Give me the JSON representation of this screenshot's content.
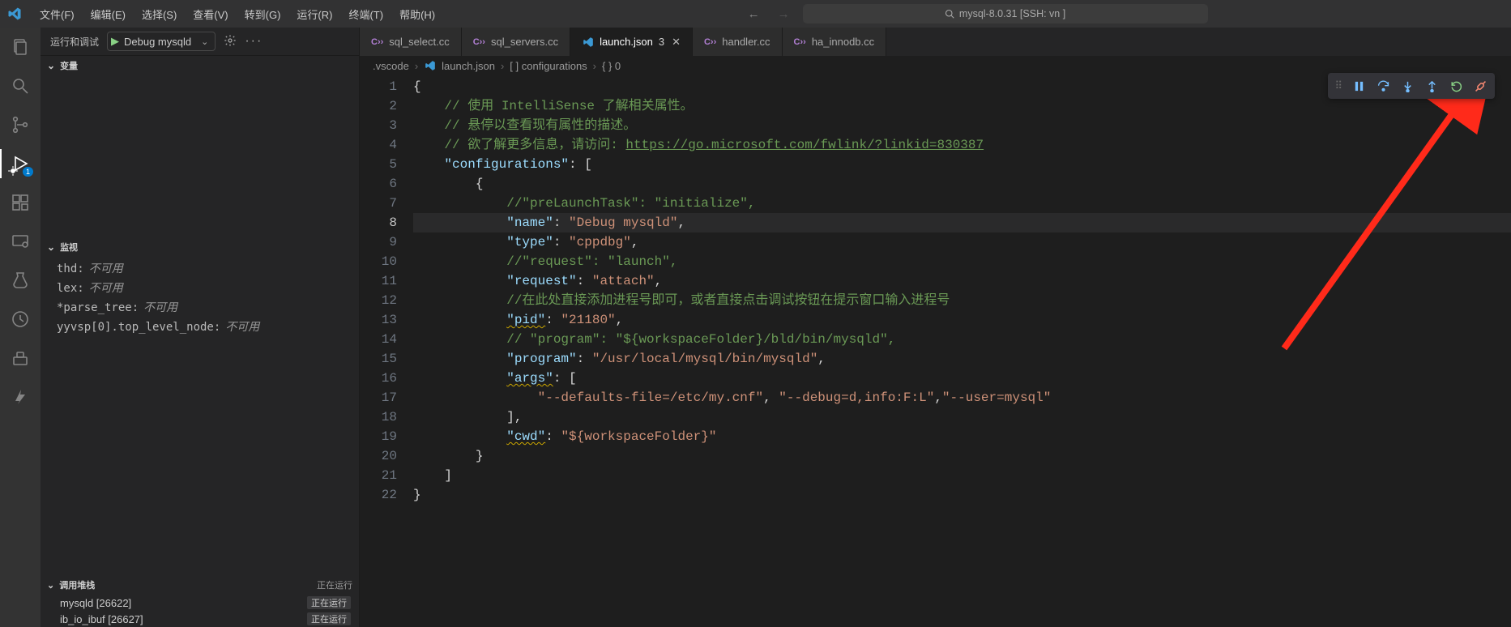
{
  "titlebar": {
    "menus": [
      "文件(F)",
      "编辑(E)",
      "选择(S)",
      "查看(V)",
      "转到(G)",
      "运行(R)",
      "终端(T)",
      "帮助(H)"
    ],
    "search_text": "mysql-8.0.31 [SSH: vn            ]"
  },
  "activity": {
    "debug_badge": "1"
  },
  "run_debug": {
    "header_title": "运行和调试",
    "config_name": "Debug mysqld",
    "sections": {
      "variables": "变量",
      "watch": "监视",
      "callstack": "调用堆栈"
    },
    "watch_items": [
      {
        "expr": "thd",
        "value": "不可用"
      },
      {
        "expr": "lex",
        "value": "不可用"
      },
      {
        "expr": "*parse_tree",
        "value": "不可用"
      },
      {
        "expr": "yyvsp[0].top_level_node",
        "value": "不可用"
      }
    ],
    "callstack_status": "正在运行",
    "callstack_items": [
      {
        "name": "mysqld [26622]",
        "status": "正在运行"
      },
      {
        "name": "ib_io_ibuf [26627]",
        "status": "正在运行"
      }
    ]
  },
  "tabs": [
    {
      "icon": "cpp",
      "label": "sql_select.cc",
      "active": false
    },
    {
      "icon": "cpp",
      "label": "sql_servers.cc",
      "active": false
    },
    {
      "icon": "json",
      "label": "launch.json",
      "modified": "3",
      "active": true,
      "close": true
    },
    {
      "icon": "cpp",
      "label": "handler.cc",
      "active": false
    },
    {
      "icon": "cpp",
      "label": "ha_innodb.cc",
      "active": false
    }
  ],
  "breadcrumb": {
    "parts": [
      ".vscode",
      "launch.json",
      "[ ] configurations",
      "{ } 0"
    ]
  },
  "code": {
    "current_line": 8,
    "lines": [
      {
        "n": 1,
        "html": "<span class='p'>{</span>"
      },
      {
        "n": 2,
        "html": "    <span class='c'>// 使用 IntelliSense 了解相关属性。</span>"
      },
      {
        "n": 3,
        "html": "    <span class='c'>// 悬停以查看现有属性的描述。</span>"
      },
      {
        "n": 4,
        "html": "    <span class='c'>// 欲了解更多信息，请访问: <span class='lnk'>https://go.microsoft.com/fwlink/?linkid=830387</span></span>"
      },
      {
        "n": 5,
        "html": "    <span class='k'>\"configurations\"</span><span class='p'>: [</span>"
      },
      {
        "n": 6,
        "html": "        <span class='p'>{</span>"
      },
      {
        "n": 7,
        "html": "            <span class='c'>//\"preLaunchTask\": \"initialize\",</span>"
      },
      {
        "n": 8,
        "html": "            <span class='k'>\"name\"</span><span class='p'>: </span><span class='s'>\"Debug mysqld\"</span><span class='p'>,</span>"
      },
      {
        "n": 9,
        "html": "            <span class='k'>\"type\"</span><span class='p'>: </span><span class='s'>\"cppdbg\"</span><span class='p'>,</span>"
      },
      {
        "n": 10,
        "html": "            <span class='c'>//\"request\": \"launch\",</span>"
      },
      {
        "n": 11,
        "html": "            <span class='k'>\"request\"</span><span class='p'>: </span><span class='s'>\"attach\"</span><span class='p'>,</span>"
      },
      {
        "n": 12,
        "html": "            <span class='c'>//在此处直接添加进程号即可，或者直接点击调试按钮在提示窗口输入进程号</span>"
      },
      {
        "n": 13,
        "html": "            <span class='k warn'>\"pid\"</span><span class='p'>: </span><span class='s'>\"21180\"</span><span class='p'>,</span>"
      },
      {
        "n": 14,
        "html": "            <span class='c'>// \"program\": \"${workspaceFolder}/bld/bin/mysqld\",</span>"
      },
      {
        "n": 15,
        "html": "            <span class='k'>\"program\"</span><span class='p'>: </span><span class='s'>\"/usr/local/mysql/bin/mysqld\"</span><span class='p'>,</span>"
      },
      {
        "n": 16,
        "html": "            <span class='k warn'>\"args\"</span><span class='p'>: [</span>"
      },
      {
        "n": 17,
        "html": "                <span class='s'>\"--defaults-file=/etc/my.cnf\"</span><span class='p'>, </span><span class='s'>\"--debug=d,info:F:L\"</span><span class='p'>,</span><span class='s'>\"--user=mysql\"</span>"
      },
      {
        "n": 18,
        "html": "            <span class='p'>],</span>"
      },
      {
        "n": 19,
        "html": "            <span class='k warn'>\"cwd\"</span><span class='p'>: </span><span class='s'>\"${workspaceFolder}\"</span>"
      },
      {
        "n": 20,
        "html": "        <span class='p'>}</span>"
      },
      {
        "n": 21,
        "html": "    <span class='p'>]</span>"
      },
      {
        "n": 22,
        "html": "<span class='p'>}</span>"
      }
    ]
  }
}
